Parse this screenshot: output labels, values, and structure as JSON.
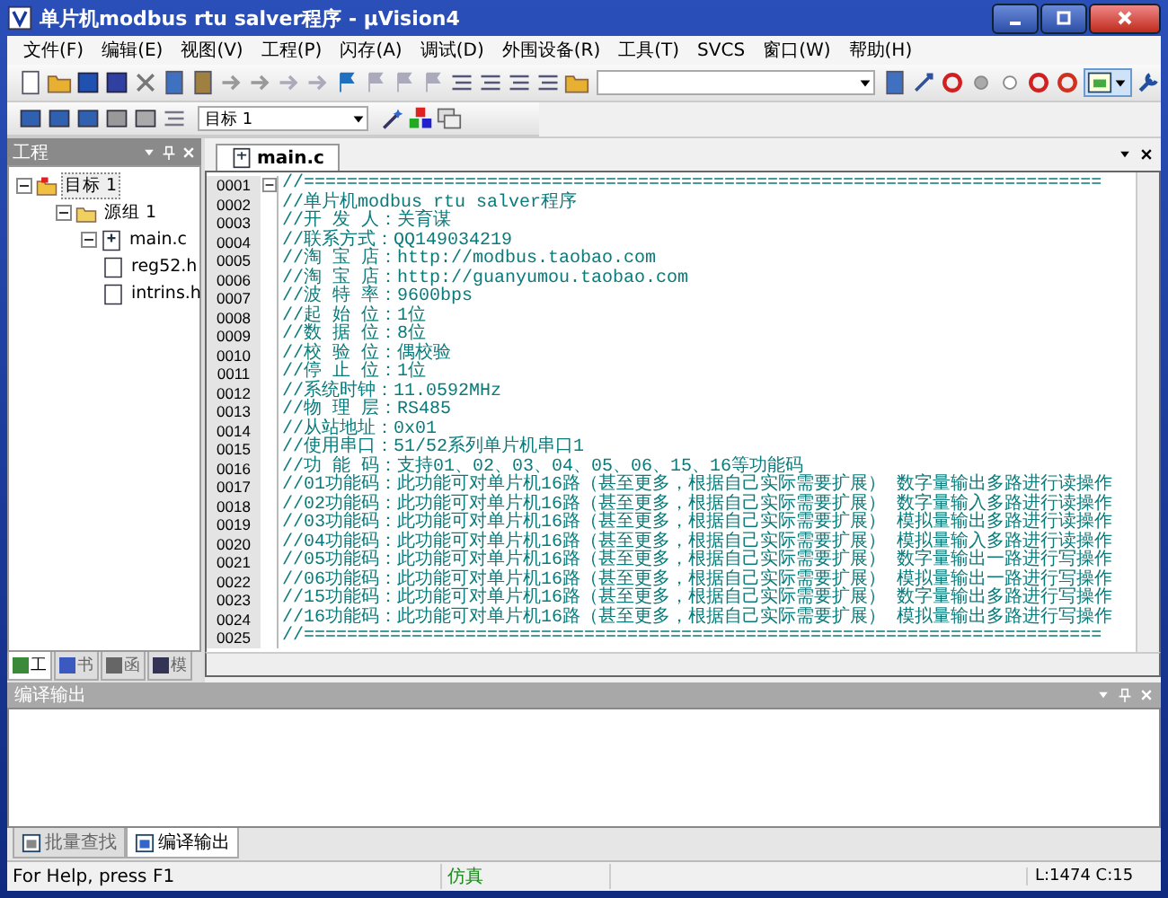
{
  "window": {
    "title": "单片机modbus rtu salver程序 - µVision4"
  },
  "menu": [
    "文件(F)",
    "编辑(E)",
    "视图(V)",
    "工程(P)",
    "闪存(A)",
    "调试(D)",
    "外围设备(R)",
    "工具(T)",
    "SVCS",
    "窗口(W)",
    "帮助(H)"
  ],
  "toolbar": {
    "target_select": {
      "value": "目标 1"
    }
  },
  "project_panel": {
    "title": "工程",
    "tree": [
      {
        "label": "目标 1",
        "kind": "target",
        "expanded": true,
        "selected": true,
        "children": [
          {
            "label": "源组 1",
            "kind": "group",
            "expanded": true,
            "selected": false,
            "children": [
              {
                "label": "main.c",
                "kind": "source",
                "expanded": true,
                "selected": false,
                "children": [
                  {
                    "label": "reg52.h",
                    "kind": "header",
                    "selected": false
                  },
                  {
                    "label": "intrins.h",
                    "kind": "header",
                    "selected": false
                  }
                ]
              }
            ]
          }
        ]
      }
    ],
    "tabs": [
      {
        "label": "工",
        "selected": true
      },
      {
        "label": "书",
        "selected": false
      },
      {
        "label": "函",
        "selected": false
      },
      {
        "label": "模",
        "selected": false
      }
    ]
  },
  "editor": {
    "tabs": [
      {
        "label": "main.c",
        "selected": true
      }
    ],
    "lines": [
      {
        "number": "0001",
        "text": "//==========================================================================",
        "fold": true
      },
      {
        "number": "0002",
        "text": "//单片机modbus rtu salver程序",
        "fold": false
      },
      {
        "number": "0003",
        "text": "//开 发 人：关育谋",
        "fold": false
      },
      {
        "number": "0004",
        "text": "//联系方式：QQ149034219",
        "fold": false
      },
      {
        "number": "0005",
        "text": "//淘 宝 店：http://modbus.taobao.com",
        "fold": false
      },
      {
        "number": "0006",
        "text": "//淘 宝 店：http://guanyumou.taobao.com",
        "fold": false
      },
      {
        "number": "0007",
        "text": "//波 特 率：9600bps",
        "fold": false
      },
      {
        "number": "0008",
        "text": "//起 始 位：1位",
        "fold": false
      },
      {
        "number": "0009",
        "text": "//数 据 位：8位",
        "fold": false
      },
      {
        "number": "0010",
        "text": "//校 验 位：偶校验",
        "fold": false
      },
      {
        "number": "0011",
        "text": "//停 止 位：1位",
        "fold": false
      },
      {
        "number": "0012",
        "text": "//系统时钟：11.0592MHz",
        "fold": false
      },
      {
        "number": "0013",
        "text": "//物 理 层：RS485",
        "fold": false
      },
      {
        "number": "0014",
        "text": "//从站地址：0x01",
        "fold": false
      },
      {
        "number": "0015",
        "text": "//使用串口：51/52系列单片机串口1",
        "fold": false
      },
      {
        "number": "0016",
        "text": "//功 能 码：支持01、02、03、04、05、06、15、16等功能码",
        "fold": false
      },
      {
        "number": "0017",
        "text": "//01功能码：此功能可对单片机16路（甚至更多，根据自己实际需要扩展） 数字量输出多路进行读操作",
        "fold": false
      },
      {
        "number": "0018",
        "text": "//02功能码：此功能可对单片机16路（甚至更多，根据自己实际需要扩展） 数字量输入多路进行读操作",
        "fold": false
      },
      {
        "number": "0019",
        "text": "//03功能码：此功能可对单片机16路（甚至更多，根据自己实际需要扩展） 模拟量输出多路进行读操作",
        "fold": false
      },
      {
        "number": "0020",
        "text": "//04功能码：此功能可对单片机16路（甚至更多，根据自己实际需要扩展） 模拟量输入多路进行读操作",
        "fold": false
      },
      {
        "number": "0021",
        "text": "//05功能码：此功能可对单片机16路（甚至更多，根据自己实际需要扩展） 数字量输出一路进行写操作",
        "fold": false
      },
      {
        "number": "0022",
        "text": "//06功能码：此功能可对单片机16路（甚至更多，根据自己实际需要扩展） 模拟量输出一路进行写操作",
        "fold": false
      },
      {
        "number": "0023",
        "text": "//15功能码：此功能可对单片机16路（甚至更多，根据自己实际需要扩展） 数字量输出多路进行写操作",
        "fold": false
      },
      {
        "number": "0024",
        "text": "//16功能码：此功能可对单片机16路（甚至更多，根据自己实际需要扩展） 模拟量输出多路进行写操作",
        "fold": false
      },
      {
        "number": "0025",
        "text": "//==========================================================================",
        "fold": false
      }
    ]
  },
  "output_panel": {
    "title": "编译输出",
    "tabs": [
      {
        "label": "批量查找",
        "selected": false
      },
      {
        "label": "编译输出",
        "selected": true
      }
    ]
  },
  "status_bar": {
    "help": "For Help, press F1",
    "mode": "仿真",
    "position": "L:1474 C:15"
  }
}
